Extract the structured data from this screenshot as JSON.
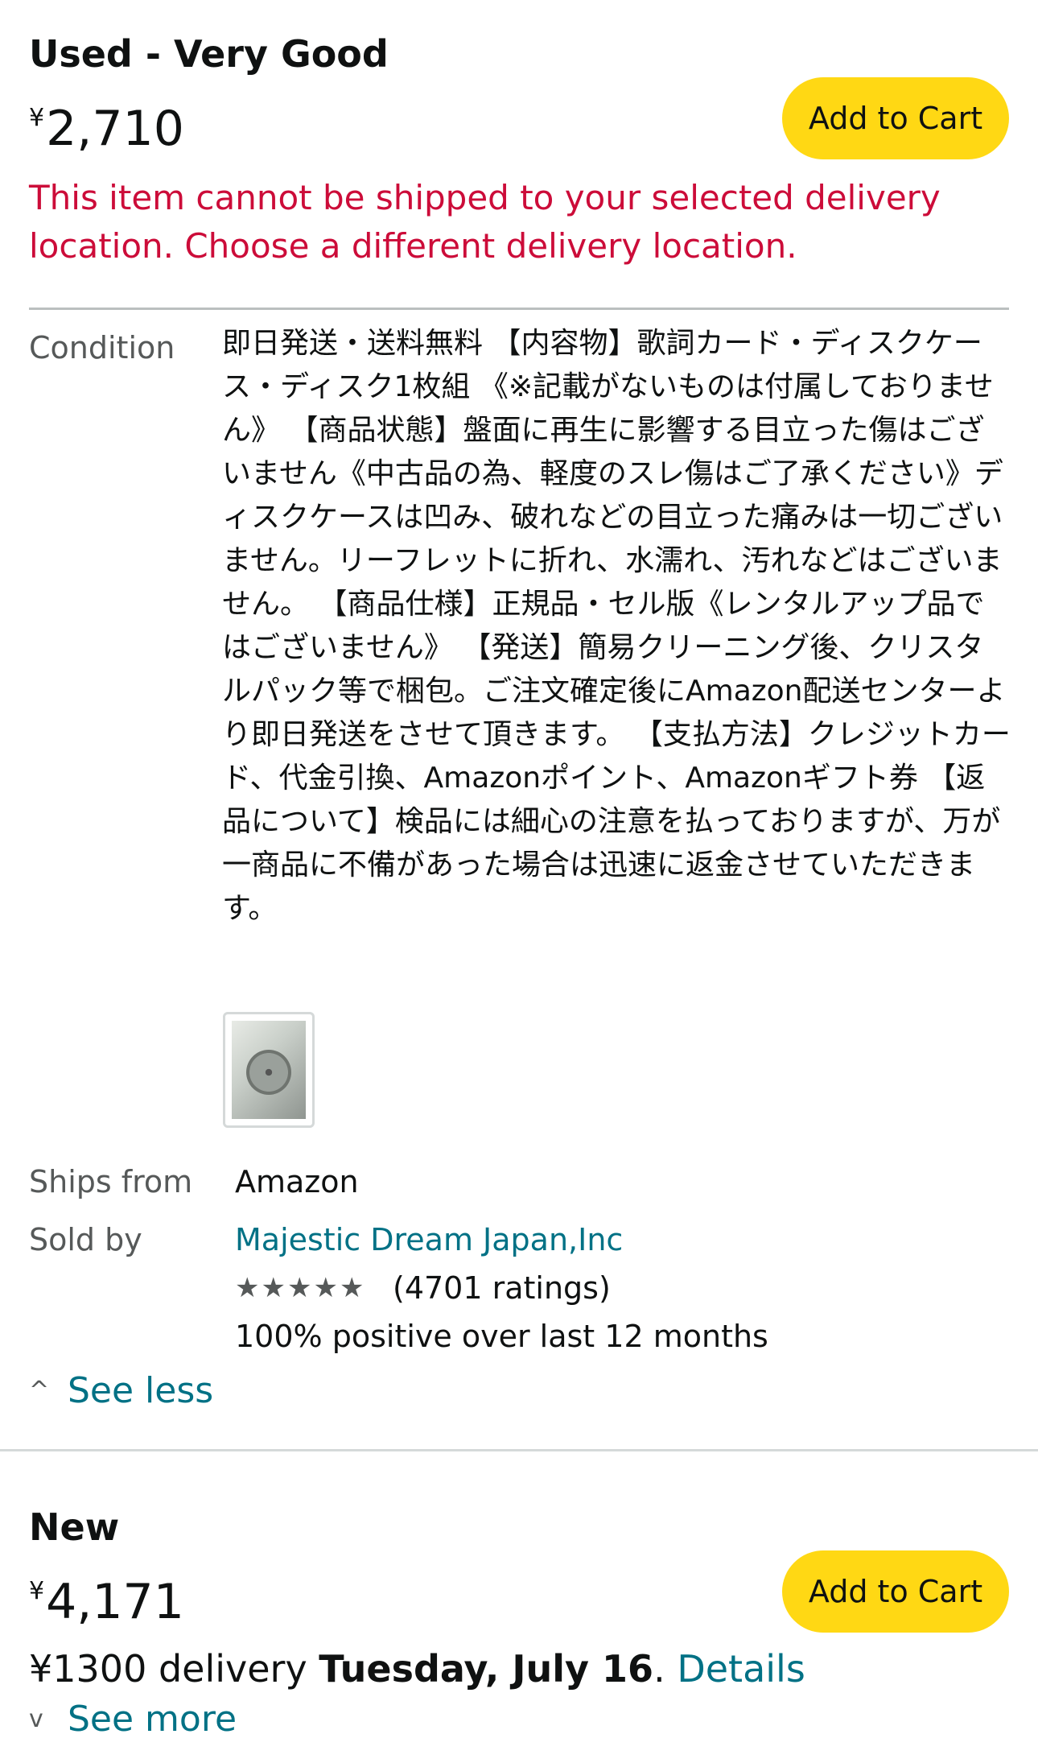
{
  "offers": [
    {
      "condition": "Used - Very Good",
      "price_symbol": "¥",
      "price": "2,710",
      "cart_label": "Add to Cart",
      "warning": "This item cannot be shipped to your selected delivery location. Choose a different delivery location.",
      "condition_label": "Condition",
      "condition_text": "即日発送・送料無料 【内容物】歌詞カード・ディスクケース・ディスク1枚組 《※記載がないものは付属しておりません》 【商品状態】盤面に再生に影響する目立った傷はございません《中古品の為、軽度のスレ傷はご了承ください》ディスクケースは凹み、破れなどの目立った痛みは一切ございません。リーフレットに折れ、水濡れ、汚れなどはございません。 【商品仕様】正規品・セル版《レンタルアップ品ではございません》 【発送】簡易クリーニング後、クリスタルパック等で梱包。ご注文確定後にAmazon配送センターより即日発送をさせて頂きます。 【支払方法】クレジットカード、代金引換、Amazonポイント、Amazonギフト券 【返品について】検品には細心の注意を払っておりますが、万が一商品に不備があった場合は迅速に返金させていただきます。",
      "ships_from_label": "Ships from",
      "ships_from": "Amazon",
      "sold_by_label": "Sold by",
      "seller": "Majestic Dream Japan,Inc",
      "rating_stars": 5,
      "ratings_count": "(4701 ratings)",
      "positive_feedback": "100% positive over last 12 months",
      "toggle_label": "See less"
    },
    {
      "condition": "New",
      "price_symbol": "¥",
      "price": "4,171",
      "cart_label": "Add to Cart",
      "delivery_prefix": "¥1300 delivery ",
      "delivery_date": "Tuesday, July 16",
      "delivery_dot": ". ",
      "details_label": "Details",
      "toggle_label": "See more"
    }
  ],
  "colors": {
    "cart_button": "#ffd814",
    "warning": "#cc0c39",
    "link": "#007185",
    "secondary_text": "#565959"
  }
}
